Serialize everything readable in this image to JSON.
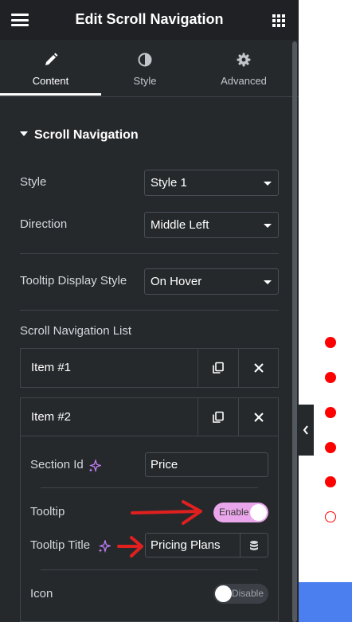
{
  "header": {
    "title": "Edit Scroll Navigation",
    "menu_icon": "hamburger-icon",
    "apps_icon": "grid-icon"
  },
  "tabs": [
    {
      "label": "Content",
      "icon": "pencil-icon",
      "active": true
    },
    {
      "label": "Style",
      "icon": "half-circle-icon",
      "active": false
    },
    {
      "label": "Advanced",
      "icon": "gear-icon",
      "active": false
    }
  ],
  "section": {
    "title": "Scroll Navigation"
  },
  "fields": {
    "style": {
      "label": "Style",
      "value": "Style 1"
    },
    "direction": {
      "label": "Direction",
      "value": "Middle Left"
    },
    "tooltip_display_style": {
      "label": "Tooltip Display Style",
      "value": "On Hover"
    }
  },
  "list": {
    "title": "Scroll Navigation List",
    "items": [
      {
        "label": "Item #1"
      },
      {
        "label": "Item #2"
      }
    ],
    "item2": {
      "section_id": {
        "label": "Section Id",
        "value": "Price"
      },
      "tooltip": {
        "label": "Tooltip",
        "toggle_text": "Enable",
        "on": true
      },
      "tooltip_title": {
        "label": "Tooltip Title",
        "value": "Pricing Plans"
      },
      "icon": {
        "label": "Icon",
        "toggle_text": "Disable",
        "on": false
      }
    }
  },
  "preview": {
    "nav_dots": [
      {
        "state": "filled"
      },
      {
        "state": "filled"
      },
      {
        "state": "filled"
      },
      {
        "state": "filled"
      },
      {
        "state": "filled"
      },
      {
        "state": "hollow"
      }
    ]
  },
  "colors": {
    "panel_bg": "#26292c",
    "header_bg": "#1f2124",
    "toggle_on": "#e9a6ea",
    "accent_sparkle": "#c17ef5",
    "annotation_arrow": "#e0201f",
    "nav_dot": "#ff0000",
    "preview_bar": "#4b7ff0"
  }
}
